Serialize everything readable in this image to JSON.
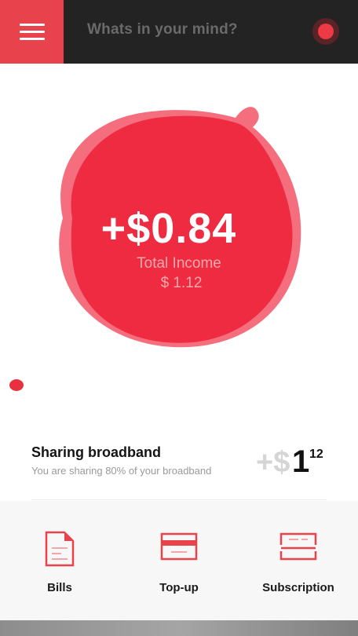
{
  "header": {
    "search_placeholder": "Whats in your mind?",
    "menu_icon": "hamburger-menu-icon",
    "record_icon": "record-dot-icon",
    "accent": "#e8424d",
    "background": "#232323"
  },
  "income": {
    "amount": "+$0.84",
    "label": "Total Income",
    "total": "$ 1.12",
    "blob_color": "#ee2b40"
  },
  "sharing": {
    "title": "Sharing broadband",
    "description": "You are sharing 80% of your broadband",
    "value_sign": "+$",
    "value_integer": "1",
    "value_decimal": "12"
  },
  "bottom_nav": {
    "items": [
      {
        "label": "Bills",
        "icon": "document-icon"
      },
      {
        "label": "Top-up",
        "icon": "card-icon"
      },
      {
        "label": "Subscription",
        "icon": "subscription-card-icon"
      }
    ]
  }
}
